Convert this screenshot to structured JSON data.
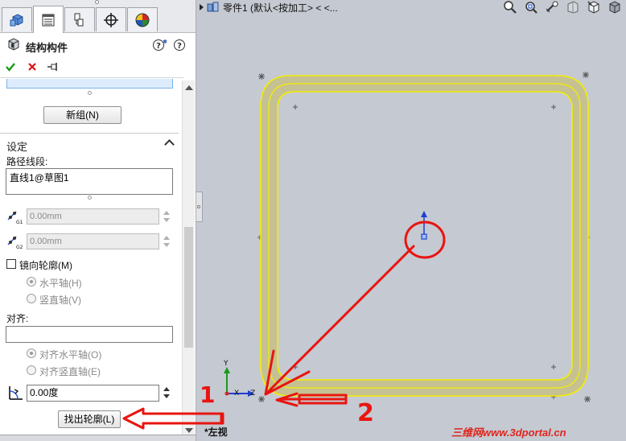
{
  "panel": {
    "tabs": [
      "feature-manager",
      "property-manager",
      "configuration-manager",
      "dimxpert-manager",
      "display-manager"
    ],
    "title": "结构构件",
    "new_group_label": "新组(N)",
    "settings_title": "设定",
    "path_segments_label": "路径线段:",
    "path_segments": [
      "直线1@草图1"
    ],
    "offset_g1": "0.00mm",
    "offset_g2": "0.00mm",
    "offset_g1_sub": "G1",
    "offset_g2_sub": "G2",
    "mirror_profile_label": "镜向轮廓(M)",
    "horizontal_axis_label": "水平轴(H)",
    "vertical_axis_label": "竖直轴(V)",
    "align_label": "对齐:",
    "align_value": "",
    "align_horizontal_label": "对齐水平轴(O)",
    "align_vertical_label": "对齐竖直轴(E)",
    "rotation_angle": "0.00度",
    "locate_profile_label": "找出轮廓(L)"
  },
  "graphics": {
    "tree_item": "零件1  (默认<按加工> < <...",
    "view_name": "*左视",
    "triad": {
      "x": "X",
      "y": "Y",
      "z": "Z"
    },
    "watermark": "三维网www.3dportal.cn",
    "annotation_1": "1",
    "annotation_2": "2",
    "hud_icons": [
      "zoom-to-fit-icon",
      "zoom-area-icon",
      "previous-view-icon",
      "section-view-icon",
      "view-orientation-icon",
      "display-style-icon"
    ]
  },
  "colors": {
    "annotation_red": "#e8150f",
    "profile_fill": "#c6c193",
    "profile_edge": "#f2ee00",
    "viewport_bg": "#c5c9d2"
  }
}
